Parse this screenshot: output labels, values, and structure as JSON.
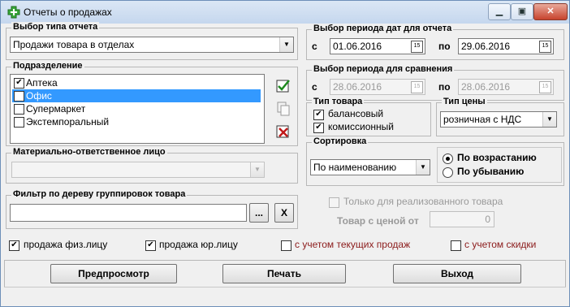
{
  "window": {
    "title": "Отчеты о продажах"
  },
  "report_type": {
    "title": "Выбор типа отчета",
    "selected": "Продажи товара в отделах"
  },
  "period": {
    "title": "Выбор периода дат для отчета",
    "from_label": "с",
    "from": "01.06.2016",
    "to_label": "по",
    "to": "29.06.2016"
  },
  "compare_period": {
    "title": "Выбор периода для сравнения",
    "from_label": "с",
    "from": "28.06.2016",
    "to_label": "по",
    "to": "28.06.2016"
  },
  "subdivision": {
    "title": "Подразделение",
    "items": [
      {
        "label": "Аптека",
        "checked": true,
        "selected": false
      },
      {
        "label": "Офис",
        "checked": true,
        "selected": true
      },
      {
        "label": "Супермаркет",
        "checked": false,
        "selected": false
      },
      {
        "label": "Экстемпоральный",
        "checked": false,
        "selected": false
      }
    ]
  },
  "product_type": {
    "title": "Тип товара",
    "options": [
      {
        "label": "балансовый",
        "checked": true
      },
      {
        "label": "комиссионный",
        "checked": true
      }
    ]
  },
  "price_type": {
    "title": "Тип цены",
    "selected": "розничная с НДС"
  },
  "sorting": {
    "title": "Сортировка",
    "selected": "По наименованию",
    "asc_label": "По возрастанию",
    "desc_label": "По убыванию",
    "direction": "asc"
  },
  "responsible": {
    "title": "Материально-ответственное лицо",
    "selected": ""
  },
  "tree_filter": {
    "title": "Фильтр по дереву группировок товара",
    "value": "",
    "browse_label": "...",
    "clear_label": "X"
  },
  "realized_only": {
    "label": "Только для реализованного товара",
    "checked": false
  },
  "price_from": {
    "label": "Товар с ценой от",
    "value": "0"
  },
  "bottom_checks": [
    {
      "label": "продажа физ.лицу",
      "checked": true
    },
    {
      "label": "продажа юр.лицу",
      "checked": true
    },
    {
      "label": "с учетом текущих продаж",
      "checked": false
    },
    {
      "label": "с учетом скидки",
      "checked": false
    }
  ],
  "buttons": {
    "preview": "Предпросмотр",
    "print": "Печать",
    "exit": "Выход"
  },
  "icons": {
    "app": "pharmacy-cross-icon",
    "check_all": "check-all-icon",
    "copy": "copy-icon",
    "uncheck_all": "uncheck-all-icon"
  },
  "colors": {
    "accent_green": "#2f9e2f",
    "selection": "#3399ff",
    "red_label": "#8b1a1a"
  }
}
